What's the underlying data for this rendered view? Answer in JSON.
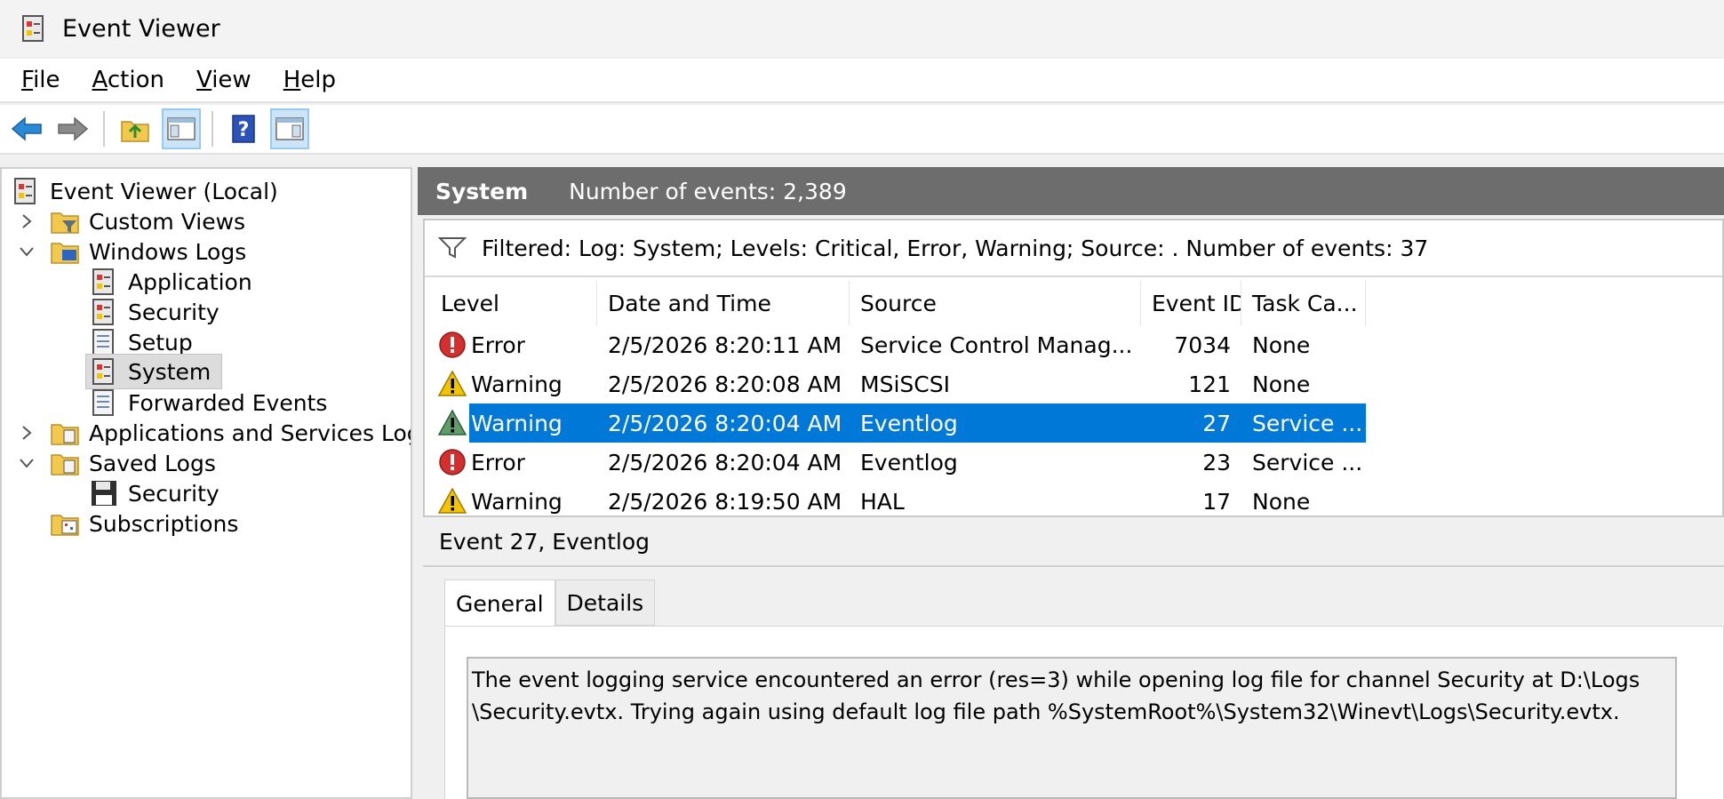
{
  "window": {
    "title": "Event Viewer"
  },
  "menu": [
    {
      "key": "F",
      "rest": "ile"
    },
    {
      "key": "A",
      "rest": "ction"
    },
    {
      "key": "V",
      "rest": "iew"
    },
    {
      "key": "H",
      "rest": "elp"
    }
  ],
  "toolbar": {
    "buttons": [
      "back-arrow-icon",
      "forward-arrow-icon",
      "up-folder-icon",
      "show-hide-console-tree-icon",
      "help-icon",
      "show-hide-action-pane-icon"
    ]
  },
  "tree": {
    "root": "Event Viewer (Local)",
    "custom_views": "Custom Views",
    "windows_logs": "Windows Logs",
    "application": "Application",
    "security": "Security",
    "setup": "Setup",
    "system": "System",
    "forwarded_events": "Forwarded Events",
    "apps_services": "Applications and Services Log",
    "saved_logs": "Saved Logs",
    "saved_security": "Security",
    "subscriptions": "Subscriptions"
  },
  "header": {
    "title": "System",
    "count": "Number of events: 2,389"
  },
  "filter": {
    "text": "Filtered: Log: System; Levels: Critical, Error, Warning; Source: . Number of events: 37"
  },
  "columns": {
    "level": "Level",
    "datetime": "Date and Time",
    "source": "Source",
    "event_id": "Event ID",
    "task": "Task Ca..."
  },
  "rows": [
    {
      "level": "Error",
      "datetime": "2/5/2026 8:20:11 AM",
      "source": "Service Control Manag...",
      "event_id": "7034",
      "task": "None"
    },
    {
      "level": "Warning",
      "datetime": "2/5/2026 8:20:08 AM",
      "source": "MSiSCSI",
      "event_id": "121",
      "task": "None"
    },
    {
      "level": "Warning",
      "datetime": "2/5/2026 8:20:04 AM",
      "source": "Eventlog",
      "event_id": "27",
      "task": "Service ..."
    },
    {
      "level": "Error",
      "datetime": "2/5/2026 8:20:04 AM",
      "source": "Eventlog",
      "event_id": "23",
      "task": "Service ..."
    },
    {
      "level": "Warning",
      "datetime": "2/5/2026 8:19:50 AM",
      "source": "HAL",
      "event_id": "17",
      "task": "None"
    }
  ],
  "detail": {
    "title": "Event 27, Eventlog",
    "tabs": [
      "General",
      "Details"
    ],
    "description_line1": "The event logging service encountered an error (res=3) while opening log file for channel Security at D:\\Logs",
    "description_line2": "\\Security.evtx. Trying again using default log file path %SystemRoot%\\System32\\Winevt\\Logs\\Security.evtx."
  },
  "colors": {
    "selection": "#0078d7",
    "header_band": "#6d6d6d",
    "error": "#d32f2f",
    "warning": "#f5c400"
  }
}
